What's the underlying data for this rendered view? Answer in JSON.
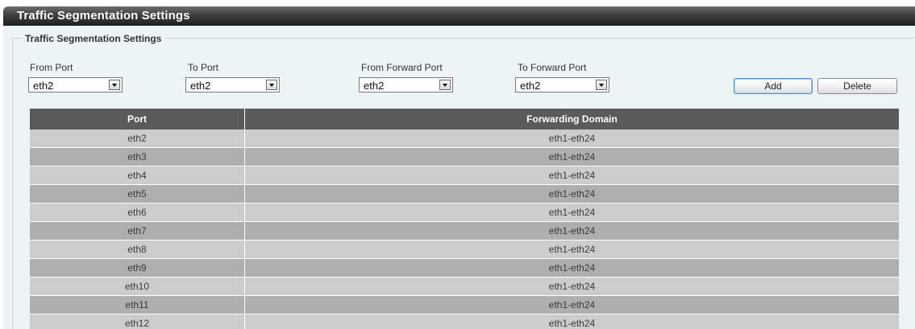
{
  "title": "Traffic Segmentation Settings",
  "section_legend": "Traffic Segmentation Settings",
  "form": {
    "from_port": {
      "label": "From Port",
      "value": "eth2"
    },
    "to_port": {
      "label": "To Port",
      "value": "eth2"
    },
    "from_forward_port": {
      "label": "From Forward Port",
      "value": "eth2"
    },
    "to_forward_port": {
      "label": "To Forward Port",
      "value": "eth2"
    },
    "add_label": "Add",
    "delete_label": "Delete"
  },
  "table": {
    "headers": [
      "Port",
      "Forwarding Domain"
    ],
    "rows": [
      {
        "port": "eth2",
        "domain": "eth1-eth24"
      },
      {
        "port": "eth3",
        "domain": "eth1-eth24"
      },
      {
        "port": "eth4",
        "domain": "eth1-eth24"
      },
      {
        "port": "eth5",
        "domain": "eth1-eth24"
      },
      {
        "port": "eth6",
        "domain": "eth1-eth24"
      },
      {
        "port": "eth7",
        "domain": "eth1-eth24"
      },
      {
        "port": "eth8",
        "domain": "eth1-eth24"
      },
      {
        "port": "eth9",
        "domain": "eth1-eth24"
      },
      {
        "port": "eth10",
        "domain": "eth1-eth24"
      },
      {
        "port": "eth11",
        "domain": "eth1-eth24"
      },
      {
        "port": "eth12",
        "domain": "eth1-eth24"
      }
    ]
  }
}
